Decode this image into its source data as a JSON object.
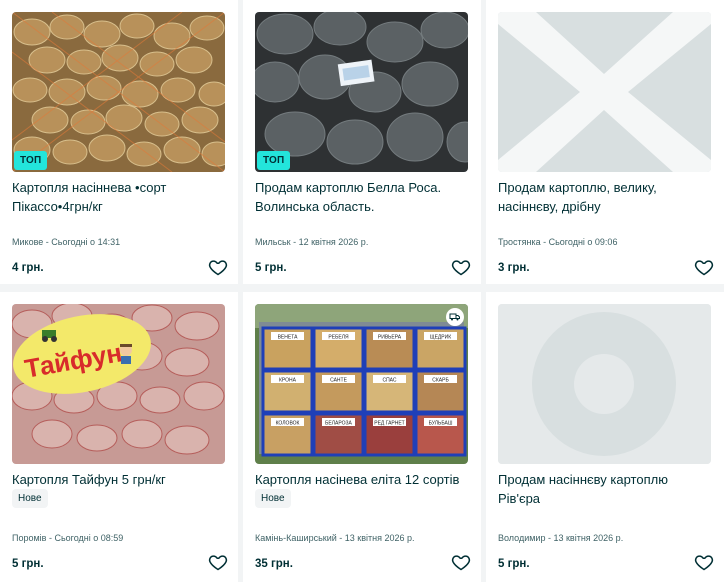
{
  "listings": [
    {
      "title": "Картопля насіннева •сорт Пікассо•4грн/кг",
      "badge": "ТОП",
      "condition": "",
      "location_date": "Микове - Сьогодні о 14:31",
      "price": "4 грн.",
      "image": "potato-sacks-photo"
    },
    {
      "title": "Продам картоплю Белла Роса. Волинська область.",
      "badge": "ТОП",
      "condition": "",
      "location_date": "Мильськ - 12 квітня 2026 р.",
      "price": "5 грн.",
      "image": "dark-potatoes-photo"
    },
    {
      "title": "Продам картоплю, велику, насіннєву, дрібну",
      "badge": "",
      "condition": "",
      "location_date": "Тростянка - Сьогодні о 09:06",
      "price": "3 грн.",
      "image": "no-image-placeholder"
    },
    {
      "title": "Картопля Тайфун 5 грн/кг",
      "badge": "",
      "condition": "Нове",
      "location_date": "Поромів - Сьогодні о 08:59",
      "price": "5 грн.",
      "image": "red-potato-sacks-photo",
      "image_text": "Тайфун"
    },
    {
      "title": "Картопля насінева еліта 12 сортів",
      "badge": "",
      "condition": "Нове",
      "location_date": "Камінь-Каширський - 13 квітня 2026 р.",
      "price": "35 грн.",
      "image": "potato-crates-photo",
      "crate_labels": [
        "ВЕНЕТА",
        "РЕБЕЛЯ",
        "РИВЬЕРА",
        "ЩЕДРИК",
        "КРОНА",
        "САНТЕ",
        "СПАС",
        "СКАРБ",
        "КОЛОВОК",
        "БЕЛАРОЗА",
        "РЕД ГАРНЕТ",
        "БУЛЬБАШ"
      ],
      "delivery_icon": "truck-icon"
    },
    {
      "title": "Продам насіннєву картоплю Рів'єра",
      "badge": "",
      "condition": "",
      "location_date": "Володимир - 13 квітня 2026 р.",
      "price": "5 грн.",
      "image": "loading-placeholder"
    }
  ],
  "colors": {
    "badge": "#23e5db",
    "text": "#002f34",
    "meta": "#406367",
    "background": "#f2f4f5"
  }
}
